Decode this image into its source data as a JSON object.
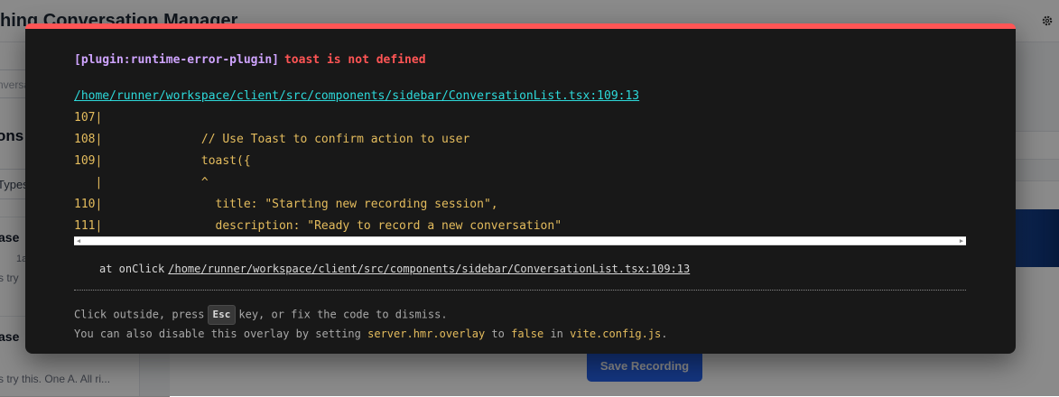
{
  "app": {
    "title": "hing Conversation Manager",
    "sidebar": {
      "search_placeholder": "nversa",
      "heading": "ons",
      "filter_label": "Types",
      "items": [
        {
          "title": "ase",
          "meta": "1a",
          "preview": "s try"
        },
        {
          "title": "ase",
          "meta": "",
          "preview": "s try this. One A. All ri..."
        }
      ]
    },
    "save_button_label": "Save Recording",
    "colors": {
      "primary": "#2563eb"
    }
  },
  "overlay": {
    "accent_color": "#ff5555",
    "plugin_tag": "[plugin:runtime-error-plugin]",
    "error_message": "toast is not defined",
    "file_location": "/home/runner/workspace/client/src/components/sidebar/ConversationList.tsx:109:13",
    "code_frame": [
      "107|",
      "108|              // Use Toast to confirm action to user",
      "109|              toast({",
      "   |              ^",
      "110|                title: \"Starting new recording session\",",
      "111|                description: \"Ready to record a new conversation\""
    ],
    "stack": {
      "prefix": "at onClick",
      "location": "/home/runner/workspace/client/src/components/sidebar/ConversationList.tsx:109:13"
    },
    "tip": {
      "line1_before": "Click outside, press",
      "key": "Esc",
      "line1_after": "key, or fix the code to dismiss.",
      "line2_before": "You can also disable this overlay by setting",
      "line2_setting": "server.hmr.overlay",
      "line2_mid": "to",
      "line2_value": "false",
      "line2_in": "in",
      "line2_file": "vite.config.js",
      "line2_end": "."
    }
  }
}
